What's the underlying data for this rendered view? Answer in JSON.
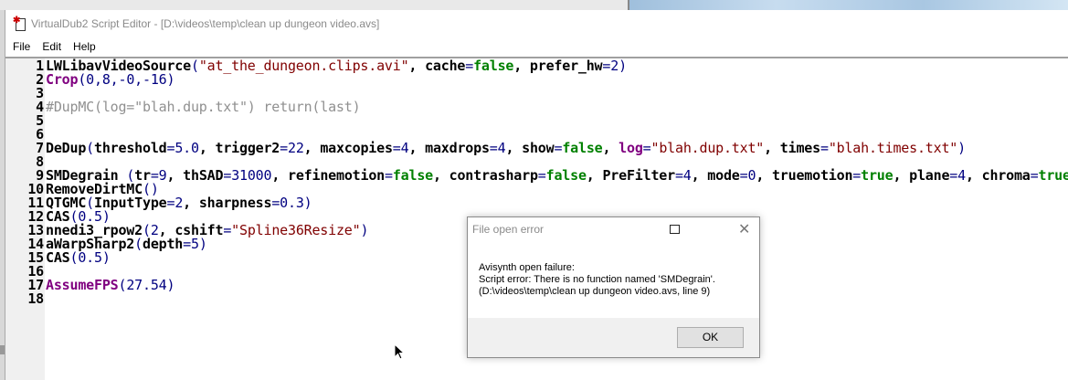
{
  "window": {
    "title": "VirtualDub2 Script Editor - [D:\\videos\\temp\\clean up dungeon video.avs]"
  },
  "menu": [
    "File",
    "Edit",
    "Help"
  ],
  "code_lines": [
    [
      [
        "LWLibavVideoSource",
        "def"
      ],
      [
        "(",
        "p"
      ],
      [
        "\"at_the_dungeon.clips.avi\"",
        "s"
      ],
      [
        ", cache",
        "def"
      ],
      [
        "=",
        "p"
      ],
      [
        "false",
        "b"
      ],
      [
        ", prefer_hw",
        "def"
      ],
      [
        "=",
        "p"
      ],
      [
        "2",
        "n"
      ],
      [
        ")",
        "p"
      ]
    ],
    [
      [
        "Crop",
        "k"
      ],
      [
        "(",
        "p"
      ],
      [
        "0,8,-0,-16",
        "n"
      ],
      [
        ")",
        "p"
      ]
    ],
    [],
    [
      [
        "#DupMC(log=\"blah.dup.txt\") return(last)",
        "c"
      ]
    ],
    [],
    [],
    [
      [
        "DeDup",
        "def"
      ],
      [
        "(",
        "p"
      ],
      [
        "threshold",
        "def"
      ],
      [
        "=",
        "p"
      ],
      [
        "5.0",
        "n"
      ],
      [
        ", trigger2",
        "def"
      ],
      [
        "=",
        "p"
      ],
      [
        "22",
        "n"
      ],
      [
        ", maxcopies",
        "def"
      ],
      [
        "=",
        "p"
      ],
      [
        "4",
        "n"
      ],
      [
        ", maxdrops",
        "def"
      ],
      [
        "=",
        "p"
      ],
      [
        "4",
        "n"
      ],
      [
        ", show",
        "def"
      ],
      [
        "=",
        "p"
      ],
      [
        "false",
        "b"
      ],
      [
        ", ",
        "def"
      ],
      [
        "log",
        "k"
      ],
      [
        "=",
        "p"
      ],
      [
        "\"blah.dup.txt\"",
        "s"
      ],
      [
        ", times",
        "def"
      ],
      [
        "=",
        "p"
      ],
      [
        "\"blah.times.txt\"",
        "s"
      ],
      [
        ")",
        "p"
      ]
    ],
    [],
    [
      [
        "SMDegrain ",
        "def"
      ],
      [
        "(",
        "p"
      ],
      [
        "tr",
        "def"
      ],
      [
        "=",
        "p"
      ],
      [
        "9",
        "n"
      ],
      [
        ", thSAD",
        "def"
      ],
      [
        "=",
        "p"
      ],
      [
        "31000",
        "n"
      ],
      [
        ", refinemotion",
        "def"
      ],
      [
        "=",
        "p"
      ],
      [
        "false",
        "b"
      ],
      [
        ", contrasharp",
        "def"
      ],
      [
        "=",
        "p"
      ],
      [
        "false",
        "b"
      ],
      [
        ", PreFilter",
        "def"
      ],
      [
        "=",
        "p"
      ],
      [
        "4",
        "n"
      ],
      [
        ", mode",
        "def"
      ],
      [
        "=",
        "p"
      ],
      [
        "0",
        "n"
      ],
      [
        ", truemotion",
        "def"
      ],
      [
        "=",
        "p"
      ],
      [
        "true",
        "b"
      ],
      [
        ", plane",
        "def"
      ],
      [
        "=",
        "p"
      ],
      [
        "4",
        "n"
      ],
      [
        ", chroma",
        "def"
      ],
      [
        "=",
        "p"
      ],
      [
        "true",
        "b"
      ],
      [
        ")",
        "p"
      ]
    ],
    [
      [
        "RemoveDirtMC",
        "def"
      ],
      [
        "()",
        "p"
      ]
    ],
    [
      [
        "QTGMC",
        "def"
      ],
      [
        "(",
        "p"
      ],
      [
        "InputType",
        "def"
      ],
      [
        "=",
        "p"
      ],
      [
        "2",
        "n"
      ],
      [
        ", sharpness",
        "def"
      ],
      [
        "=",
        "p"
      ],
      [
        "0.3",
        "n"
      ],
      [
        ")",
        "p"
      ]
    ],
    [
      [
        "CAS",
        "def"
      ],
      [
        "(",
        "p"
      ],
      [
        "0.5",
        "n"
      ],
      [
        ")",
        "p"
      ]
    ],
    [
      [
        "nnedi3_rpow2",
        "def"
      ],
      [
        "(",
        "p"
      ],
      [
        "2",
        "n"
      ],
      [
        ", cshift",
        "def"
      ],
      [
        "=",
        "p"
      ],
      [
        "\"Spline36Resize\"",
        "s"
      ],
      [
        ")",
        "p"
      ]
    ],
    [
      [
        "aWarpSharp2",
        "def"
      ],
      [
        "(",
        "p"
      ],
      [
        "depth",
        "def"
      ],
      [
        "=",
        "p"
      ],
      [
        "5",
        "n"
      ],
      [
        ")",
        "p"
      ]
    ],
    [
      [
        "CAS",
        "def"
      ],
      [
        "(",
        "p"
      ],
      [
        "0.5",
        "n"
      ],
      [
        ")",
        "p"
      ]
    ],
    [],
    [
      [
        "AssumeFPS",
        "k"
      ],
      [
        "(",
        "p"
      ],
      [
        "27.54",
        "n"
      ],
      [
        ")",
        "p"
      ]
    ],
    []
  ],
  "dialog": {
    "title": "File open error",
    "message_lines": [
      "Avisynth open failure:",
      "Script error: There is no function named 'SMDegrain'.",
      "(D:\\videos\\temp\\clean up dungeon video.avs, line 9)"
    ],
    "ok_label": "OK"
  },
  "colors": {
    "default": "#000000",
    "paren_number": "#000080",
    "string": "#800000",
    "boolean": "#008000",
    "keyword": "#800080",
    "comment": "#909090"
  }
}
